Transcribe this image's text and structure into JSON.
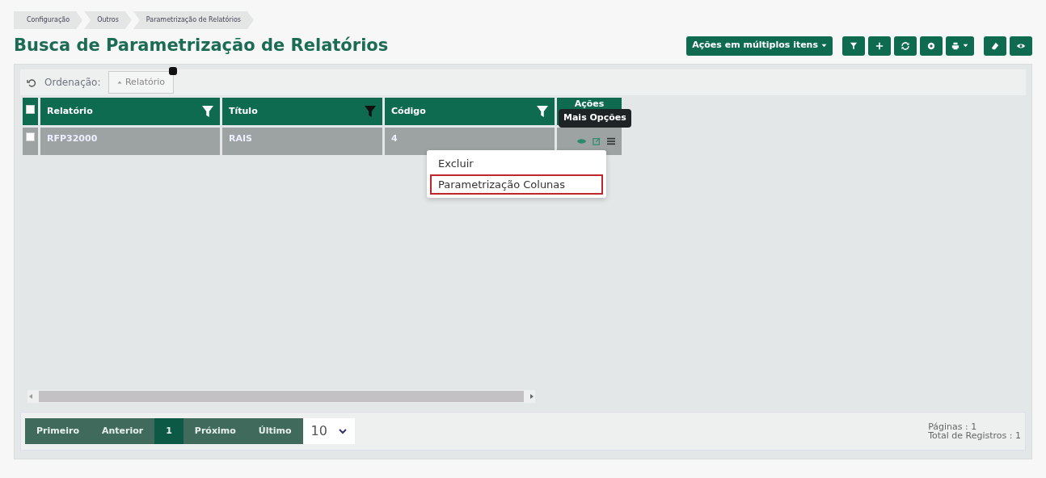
{
  "breadcrumb": [
    {
      "label": "Configuração"
    },
    {
      "label": "Outros"
    },
    {
      "label": "Parametrização de Relatórios"
    }
  ],
  "title": "Busca de Parametrização de Relatórios",
  "toolbar": {
    "bulk_actions": "Ações em múltiplos itens",
    "buttons": [
      {
        "kind": "filter"
      },
      {
        "kind": "add"
      },
      {
        "kind": "refresh"
      },
      {
        "kind": "settings"
      },
      {
        "kind": "print"
      },
      {
        "kind": "erase"
      },
      {
        "kind": "view"
      }
    ]
  },
  "sorting": {
    "label": "Ordenação:",
    "chips": [
      {
        "label": "Relatório"
      }
    ]
  },
  "table": {
    "select_all_checked": false,
    "columns": [
      {
        "label": "Relatório",
        "filter_active": false
      },
      {
        "label": "Título",
        "filter_active": true
      },
      {
        "label": "Código",
        "filter_active": false
      },
      {
        "label": "Ações"
      }
    ],
    "rows": [
      {
        "checked": false,
        "cells": [
          "RFP32000",
          "RAIS",
          "4"
        ]
      }
    ]
  },
  "tooltip": "Mais Opções",
  "menu": [
    {
      "label": "Excluir",
      "highlighted": false
    },
    {
      "label": "Parametrização Colunas",
      "highlighted": true
    }
  ],
  "pagination": {
    "buttons": [
      {
        "label": "Primeiro",
        "selected": false
      },
      {
        "label": "Anterior",
        "selected": false
      },
      {
        "label": "1",
        "selected": true
      },
      {
        "label": "Próximo",
        "selected": false
      },
      {
        "label": "Último",
        "selected": false
      }
    ],
    "page_size": "10"
  },
  "summary": [
    "Páginas : 1",
    "Total de Registros : 1"
  ]
}
